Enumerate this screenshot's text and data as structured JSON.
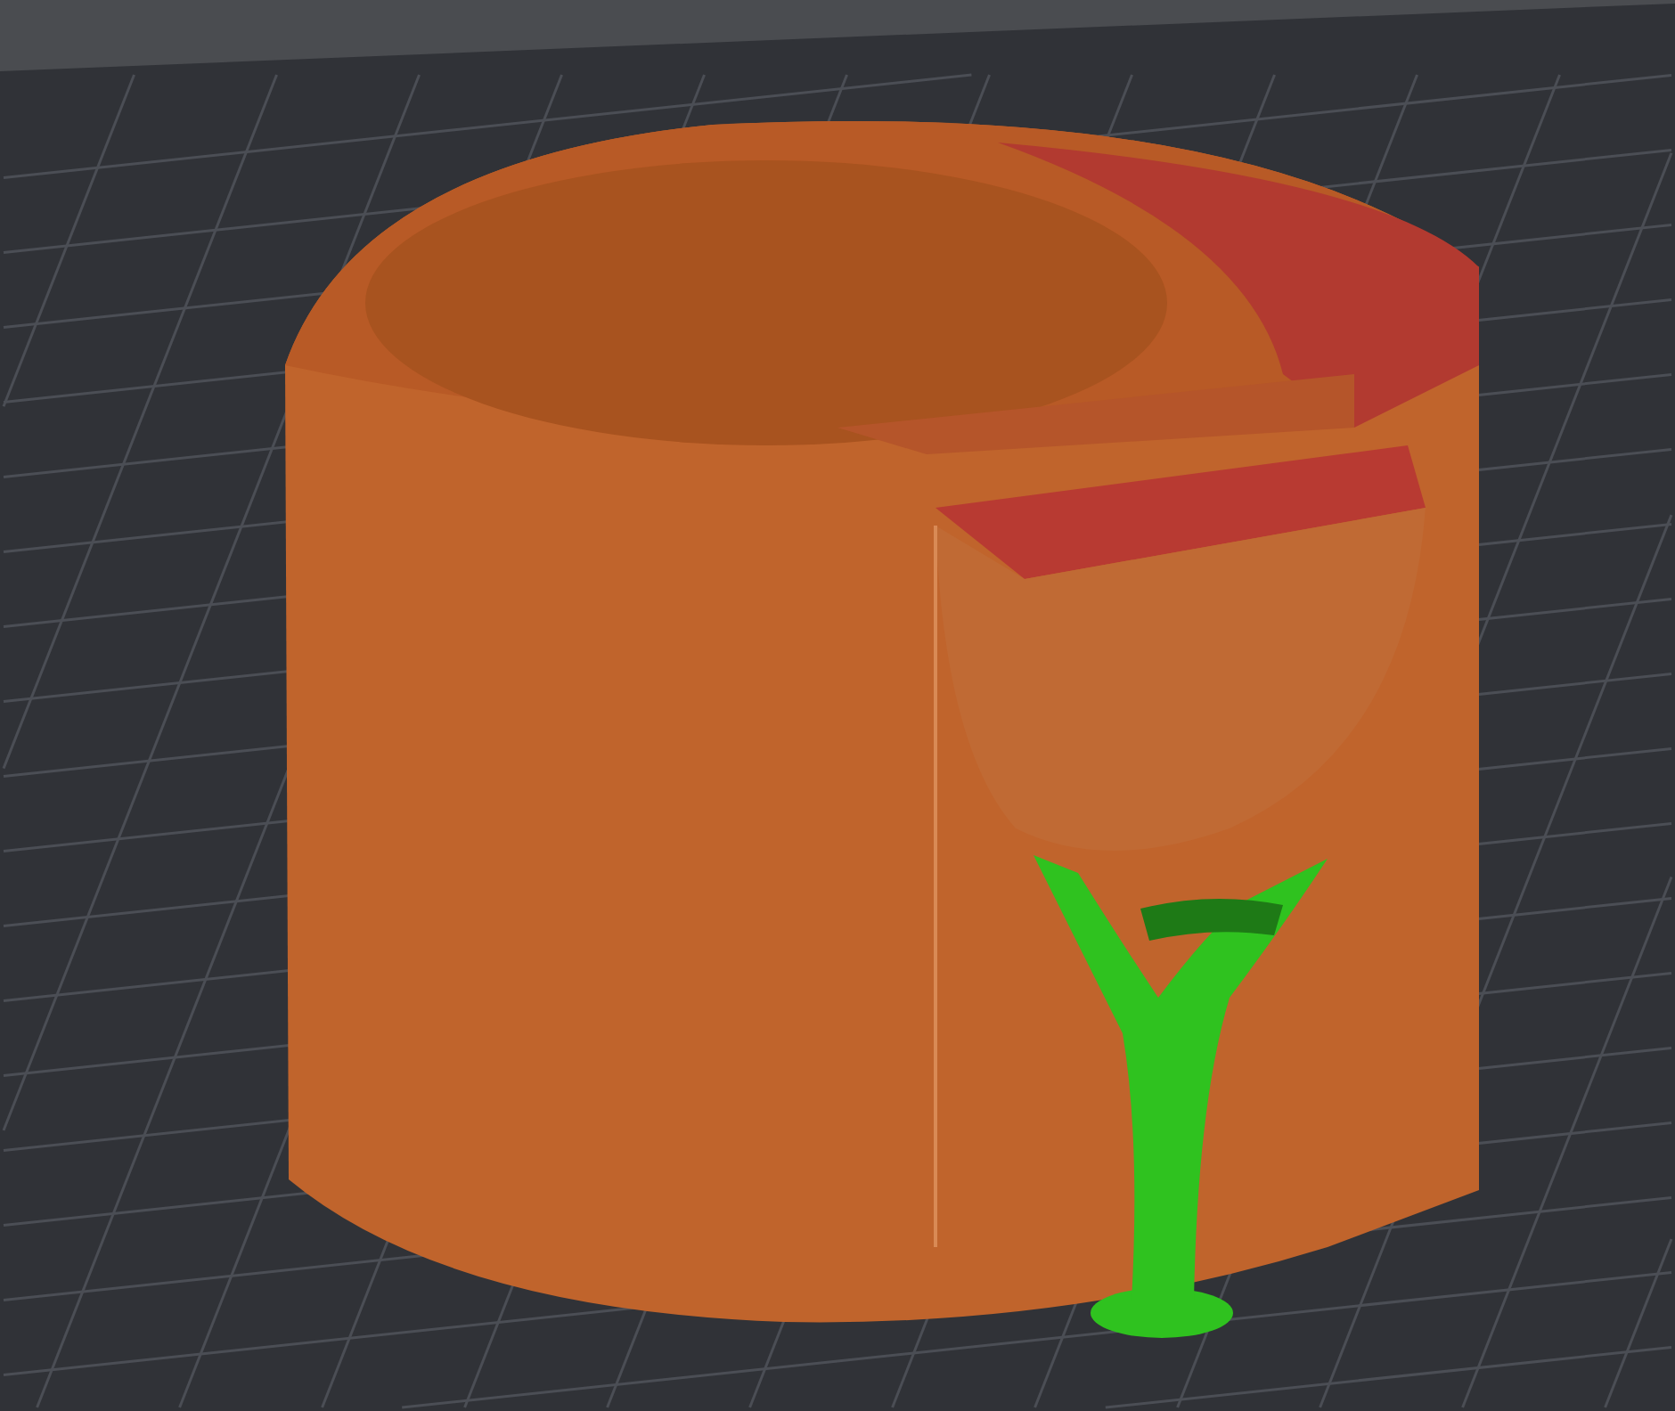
{
  "viewport": {
    "show_grid": true,
    "objects": [
      {
        "kind": "print"
      },
      {
        "kind": "support"
      }
    ]
  }
}
